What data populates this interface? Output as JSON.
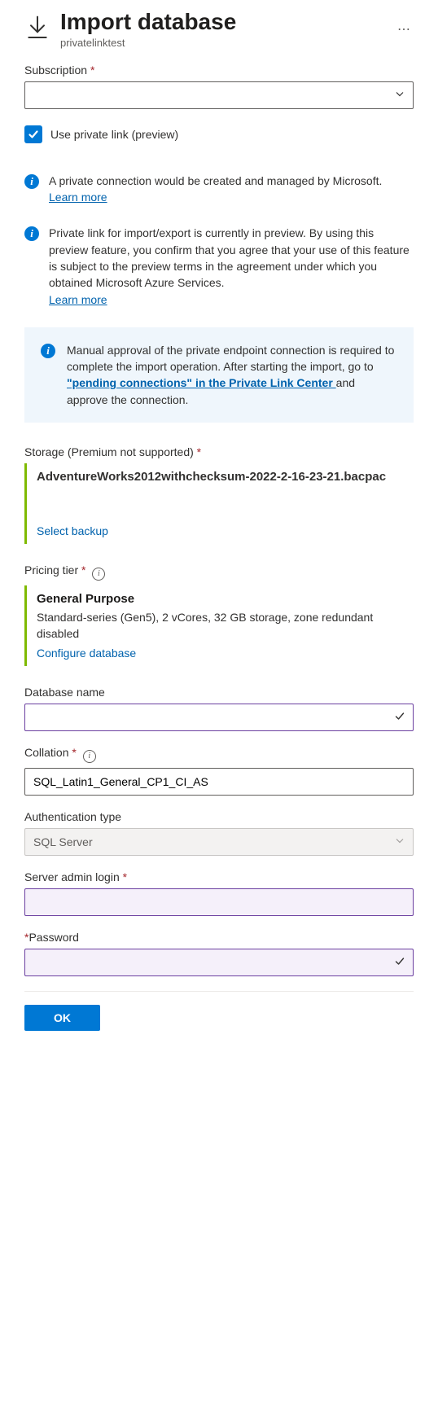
{
  "header": {
    "title": "Import database",
    "subtitle": "privatelinktest"
  },
  "subscription": {
    "label": "Subscription",
    "value": ""
  },
  "privateLinkCheckbox": {
    "label": "Use private link (preview)",
    "checked": true
  },
  "info1": {
    "text": "A private connection would be created and managed by Microsoft.",
    "link": "Learn more"
  },
  "info2": {
    "text": "Private link for import/export is currently in preview. By using this preview feature, you confirm that you agree that your use of this feature is subject to the preview terms in the agreement under which you obtained Microsoft Azure Services.",
    "link": "Learn more"
  },
  "callout": {
    "textBefore": "Manual approval of the private endpoint connection is required to complete the import operation. After starting the import, go to ",
    "linkText": "\"pending connections\" in the Private Link Center ",
    "textAfter": "and approve the connection."
  },
  "storage": {
    "label": "Storage (Premium not supported)",
    "fileName": "AdventureWorks2012withchecksum-2022-2-16-23-21.bacpac",
    "action": "Select backup"
  },
  "pricingTier": {
    "label": "Pricing tier",
    "title": "General Purpose",
    "description": "Standard-series (Gen5), 2 vCores, 32 GB storage, zone redundant disabled",
    "action": "Configure database"
  },
  "databaseName": {
    "label": "Database name",
    "value": ""
  },
  "collation": {
    "label": "Collation",
    "value": "SQL_Latin1_General_CP1_CI_AS"
  },
  "authType": {
    "label": "Authentication type",
    "value": "SQL Server"
  },
  "serverAdmin": {
    "label": "Server admin login",
    "value": ""
  },
  "password": {
    "label": "Password",
    "value": ""
  },
  "footer": {
    "okLabel": "OK"
  }
}
